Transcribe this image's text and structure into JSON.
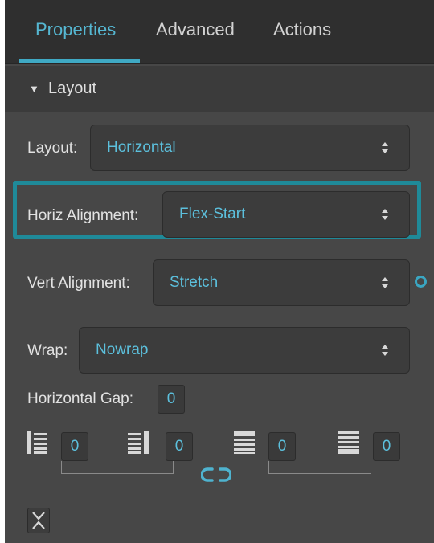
{
  "tabs": [
    {
      "label": "Properties",
      "active": true
    },
    {
      "label": "Advanced",
      "active": false
    },
    {
      "label": "Actions",
      "active": false
    }
  ],
  "section": {
    "title": "Layout",
    "expanded_icon": "triangle-down-icon"
  },
  "fields": {
    "layout": {
      "label": "Layout:",
      "value": "Horizontal"
    },
    "horiz_alignment": {
      "label": "Horiz Alignment:",
      "value": "Flex-Start"
    },
    "vert_alignment": {
      "label": "Vert Alignment:",
      "value": "Stretch"
    },
    "wrap": {
      "label": "Wrap:",
      "value": "Nowrap"
    },
    "horizontal_gap": {
      "label": "Horizontal Gap:",
      "value": "0"
    }
  },
  "padding": {
    "left": "0",
    "right": "0",
    "top": "0",
    "bottom": "0",
    "link_icon": "link-icon"
  },
  "colors": {
    "accent": "#55b7d2",
    "highlight_border": "#1f8a99",
    "panel_bg": "#474747",
    "tabbar_bg": "#2f2f2f"
  }
}
